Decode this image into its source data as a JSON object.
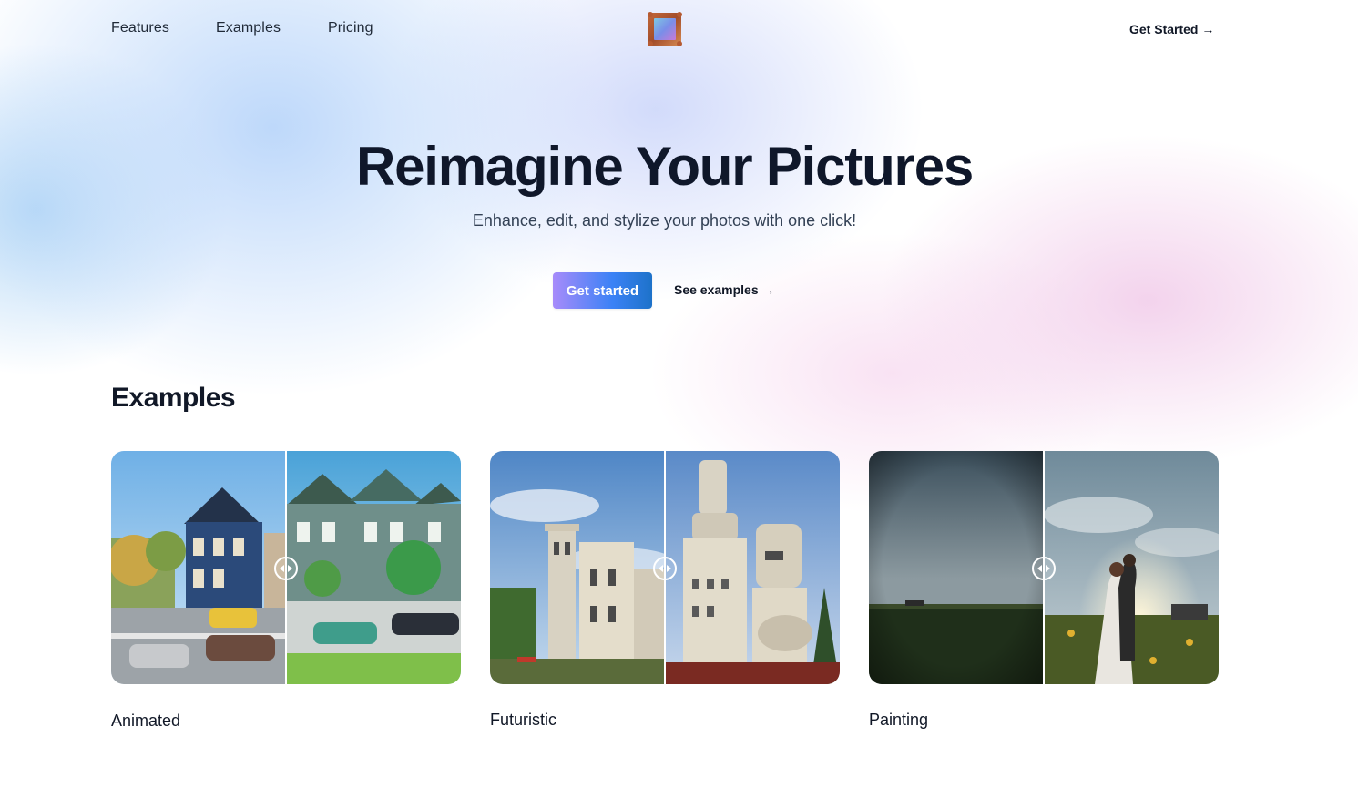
{
  "nav": {
    "links": [
      "Features",
      "Examples",
      "Pricing"
    ],
    "cta": "Get Started →",
    "logo_icon": "picture-frame-icon"
  },
  "hero": {
    "title": "Reimagine Your Pictures",
    "subtitle": "Enhance, edit, and stylize your photos with one click!",
    "primary_button": "Get started",
    "secondary_link": "See examples →"
  },
  "examples": {
    "heading": "Examples",
    "items": [
      {
        "label": "Animated",
        "handle_icon": "compare-slider-icon"
      },
      {
        "label": "Futuristic",
        "handle_icon": "compare-slider-icon"
      },
      {
        "label": "Painting",
        "handle_icon": "compare-slider-icon"
      }
    ]
  },
  "colors": {
    "text": "#111827",
    "button_gradient_start": "#a78bfa",
    "button_gradient_end": "#1d72c9",
    "background_blue": "#bad6fa",
    "background_pink": "#f0c8e8"
  }
}
